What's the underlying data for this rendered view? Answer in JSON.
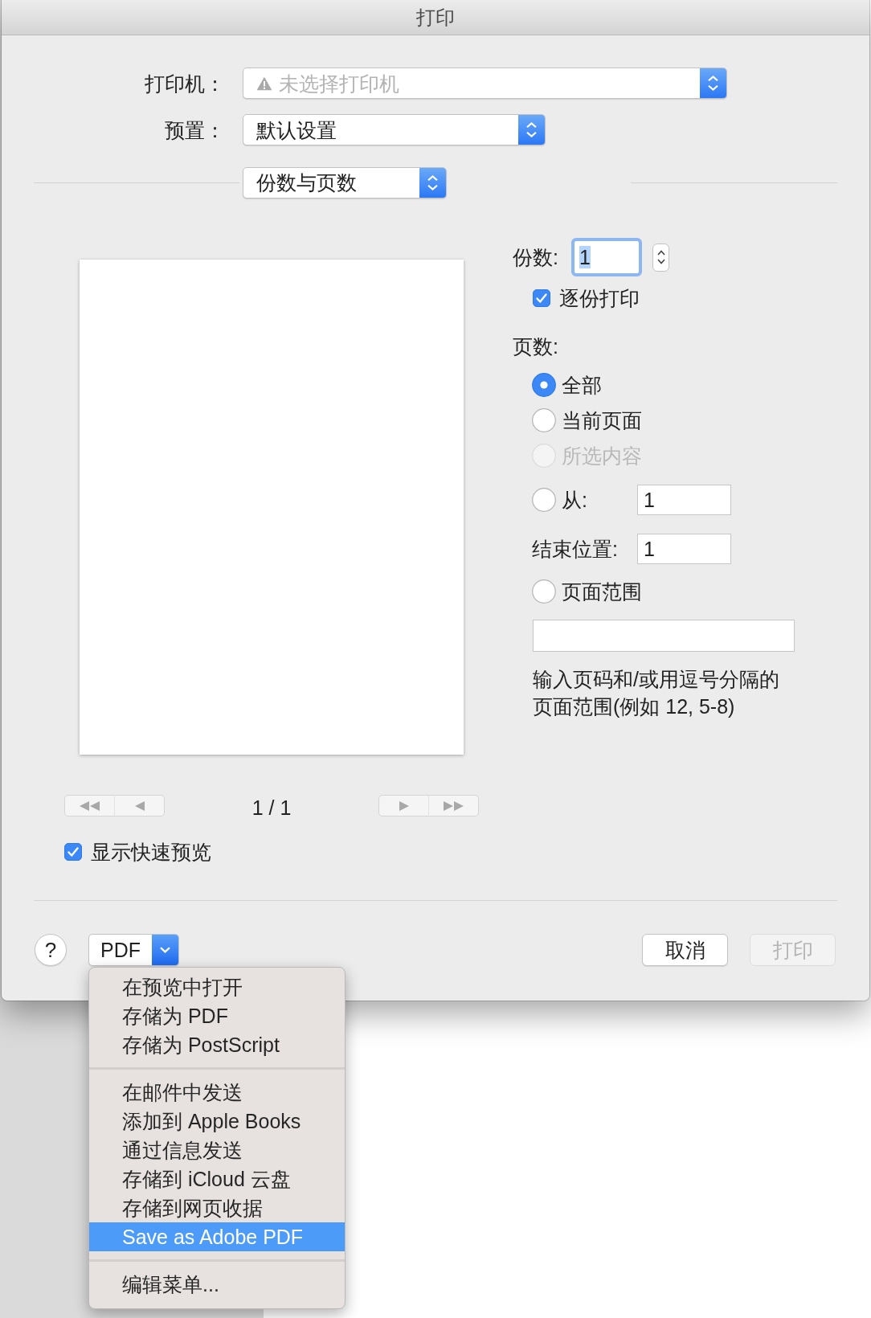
{
  "window": {
    "title": "打印"
  },
  "printer": {
    "label": "打印机：",
    "value": "未选择打印机",
    "available": false
  },
  "presets": {
    "label": "预置：",
    "value": "默认设置"
  },
  "section": {
    "value": "份数与页数"
  },
  "preview": {
    "page_indicator": "1 / 1"
  },
  "quick_preview": {
    "label": "显示快速预览",
    "checked": true
  },
  "copies": {
    "label": "份数:",
    "value": "1",
    "focused": true
  },
  "collate": {
    "label": "逐份打印",
    "checked": true
  },
  "pages": {
    "label": "页数:",
    "options": [
      {
        "kind": "radio",
        "label": "全部",
        "selected": true,
        "disabled": false
      },
      {
        "kind": "radio",
        "label": "当前页面",
        "selected": false,
        "disabled": false
      },
      {
        "kind": "radio",
        "label": "所选内容",
        "selected": false,
        "disabled": true
      },
      {
        "kind": "radio_field",
        "label": "从:",
        "value": "1",
        "selected": false,
        "disabled": false
      },
      {
        "kind": "field",
        "label": "结束位置:",
        "value": "1"
      },
      {
        "kind": "radio_box",
        "label": "页面范围",
        "selected": false,
        "disabled": false
      },
      {
        "kind": "hint",
        "text": "输入页码和/或用逗号分隔的页面范围(例如 12, 5-8)"
      }
    ]
  },
  "footer": {
    "help": "?",
    "pdf": "PDF",
    "buttons": [
      {
        "label": "取消",
        "disabled": false
      },
      {
        "label": "打印",
        "disabled": true
      }
    ]
  },
  "pdf_menu": {
    "items": [
      {
        "kind": "item",
        "label": "在预览中打开",
        "selected": false
      },
      {
        "kind": "item",
        "label": "存储为 PDF",
        "selected": false
      },
      {
        "kind": "item",
        "label": "存储为 PostScript",
        "selected": false
      },
      {
        "kind": "separator"
      },
      {
        "kind": "item",
        "label": "在邮件中发送",
        "selected": false
      },
      {
        "kind": "item",
        "label": "添加到 Apple Books",
        "selected": false
      },
      {
        "kind": "item",
        "label": "通过信息发送",
        "selected": false
      },
      {
        "kind": "item",
        "label": "存储到 iCloud 云盘",
        "selected": false
      },
      {
        "kind": "item",
        "label": "存储到网页收据",
        "selected": false
      },
      {
        "kind": "item",
        "label": "Save as Adobe PDF",
        "selected": true
      },
      {
        "kind": "separator"
      },
      {
        "kind": "item",
        "label": "编辑菜单...",
        "selected": false
      }
    ]
  }
}
